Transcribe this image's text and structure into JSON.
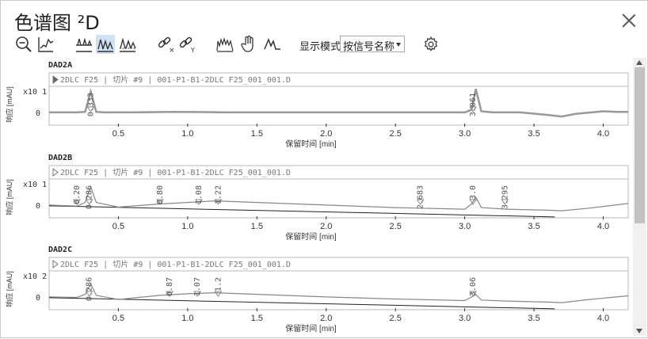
{
  "window": {
    "title": "色谱图 ²D"
  },
  "toolbar": {
    "buttons": [
      {
        "icon": "zoom-out-icon"
      },
      {
        "icon": "autoscale-icon"
      },
      {
        "icon": "single-stack-icon"
      },
      {
        "icon": "overlay-stack-icon",
        "active": true
      },
      {
        "icon": "stack-offset-icon"
      },
      {
        "icon": "link-x-icon"
      },
      {
        "icon": "link-y-icon"
      },
      {
        "icon": "spectrum-icon"
      },
      {
        "icon": "pan-hand-icon"
      },
      {
        "icon": "peak-icon"
      }
    ],
    "display_mode_label": "显示模式",
    "display_mode_value": "按信号名称",
    "settings_icon": "gear-icon"
  },
  "axis": {
    "xlabel": "保留时间 [min]",
    "ylabel": "响应 [mAU]",
    "xlim": [
      0.0,
      4.18
    ],
    "xticks": [
      "0.5",
      "1.0",
      "1.5",
      "2.0",
      "2.5",
      "3.0",
      "3.5",
      "4.0"
    ]
  },
  "chart_data": [
    {
      "type": "line",
      "name": "DAD2A",
      "header": "2DLC F25 | 切片 #9 | 001-P1-B1-2DLC F25_001_001.D",
      "y_exponent": "x10 1",
      "ytick": "0",
      "x": [
        0.0,
        0.2,
        0.26,
        0.3,
        0.34,
        0.4,
        0.6,
        0.9,
        1.3,
        2.0,
        2.6,
        3.0,
        3.05,
        3.08,
        3.12,
        3.2,
        3.4,
        3.6,
        3.7,
        3.8,
        4.0,
        4.1,
        4.18
      ],
      "y": [
        0.0,
        0.0,
        0.1,
        4.0,
        0.1,
        0.0,
        0.0,
        0.1,
        0.0,
        0.0,
        0.0,
        0.0,
        0.5,
        4.5,
        0.2,
        0.0,
        0.0,
        -0.5,
        -0.8,
        -0.3,
        0.2,
        0.1,
        0.1
      ],
      "peaks": [
        {
          "label": "0.333",
          "rt": 0.3
        },
        {
          "label": "3.061",
          "rt": 3.06
        }
      ]
    },
    {
      "type": "line",
      "name": "DAD2B",
      "header": "2DLC F25 | 切片 #9 | 001-P1-B1-2DLC F25_001_001.D",
      "y_exponent": "x10 1",
      "ytick": "0",
      "x": [
        0.0,
        0.2,
        0.26,
        0.3,
        0.34,
        0.5,
        0.8,
        1.0,
        1.2,
        1.5,
        2.0,
        2.5,
        3.0,
        3.05,
        3.08,
        3.12,
        3.3,
        3.6,
        3.7,
        3.9,
        4.18
      ],
      "y": [
        0.0,
        -0.2,
        0.5,
        3.5,
        0.5,
        -0.4,
        0.2,
        0.5,
        0.8,
        0.5,
        0.0,
        -0.5,
        -0.8,
        0.2,
        1.5,
        -0.5,
        -0.8,
        -1.0,
        -1.1,
        -0.6,
        0.3
      ],
      "peaks": [
        {
          "label": "0.20",
          "rt": 0.2
        },
        {
          "label": "0.286",
          "rt": 0.29
        },
        {
          "label": "0.80",
          "rt": 0.8
        },
        {
          "label": "1.08",
          "rt": 1.08
        },
        {
          "label": "1.22",
          "rt": 1.22
        },
        {
          "label": "2.683",
          "rt": 2.68
        },
        {
          "label": "3.0",
          "rt": 3.06
        },
        {
          "label": "3.295",
          "rt": 3.29
        }
      ]
    },
    {
      "type": "line",
      "name": "DAD2C",
      "header": "2DLC F25 | 切片 #9 | 001-P1-B1-2DLC F25_001_001.D",
      "y_exponent": "x10 2",
      "ytick": "0",
      "x": [
        0.0,
        0.2,
        0.26,
        0.3,
        0.34,
        0.5,
        0.8,
        1.0,
        1.2,
        1.5,
        2.0,
        2.5,
        3.0,
        3.05,
        3.08,
        3.12,
        3.3,
        3.6,
        3.7,
        3.9,
        4.18
      ],
      "y": [
        0.0,
        -0.1,
        0.5,
        2.5,
        0.3,
        -0.5,
        0.3,
        0.6,
        0.8,
        0.5,
        0.0,
        -0.4,
        -0.7,
        0.0,
        0.5,
        -0.6,
        -0.8,
        -1.0,
        -1.1,
        -0.5,
        0.2
      ],
      "peaks": [
        {
          "label": "0.286",
          "rt": 0.29
        },
        {
          "label": "0.87",
          "rt": 0.87
        },
        {
          "label": "1.07",
          "rt": 1.07
        },
        {
          "label": "1.2",
          "rt": 1.22
        },
        {
          "label": "3.06",
          "rt": 3.06
        }
      ]
    }
  ]
}
